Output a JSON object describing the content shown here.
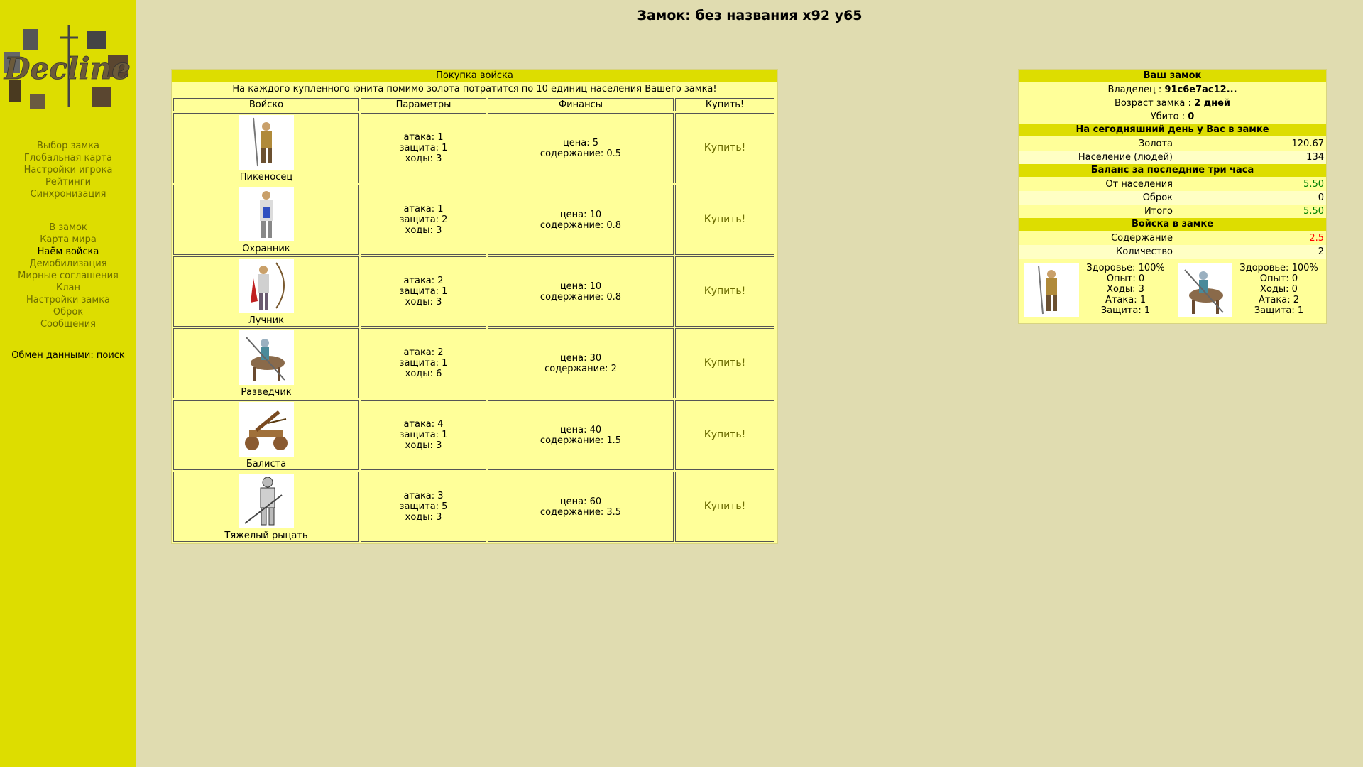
{
  "title": "Замок: без названия x92 y65",
  "sidebar": {
    "nav1": [
      "Выбор замка",
      "Глобальная карта",
      "Настройки игрока",
      "Рейтинги",
      "Синхронизация"
    ],
    "nav2": [
      "В замок",
      "Карта мира",
      "Наём войска",
      "Демобилизация",
      "Мирные соглашения",
      "Клан",
      "Настройки замка",
      "Оброк",
      "Сообщения"
    ],
    "active": "Наём войска",
    "exchange": "Обмен данными: поиск"
  },
  "buy": {
    "header": "Покупка войска",
    "note": "На каждого купленного юнита помимо золота потратится по 10 единиц населения Вашего замка!",
    "columns": [
      "Войско",
      "Параметры",
      "Финансы",
      "Купить!"
    ],
    "units": [
      {
        "name": "Пикеносец",
        "attack": "атака: 1",
        "defense": "защита: 1",
        "moves": "ходы: 3",
        "price": "цена: 5",
        "upkeep": "содержание: 0.5",
        "buy": "Купить!"
      },
      {
        "name": "Охранник",
        "attack": "атака: 1",
        "defense": "защита: 2",
        "moves": "ходы: 3",
        "price": "цена: 10",
        "upkeep": "содержание: 0.8",
        "buy": "Купить!"
      },
      {
        "name": "Лучник",
        "attack": "атака: 2",
        "defense": "защита: 1",
        "moves": "ходы: 3",
        "price": "цена: 10",
        "upkeep": "содержание: 0.8",
        "buy": "Купить!"
      },
      {
        "name": "Разведчик",
        "attack": "атака: 2",
        "defense": "защита: 1",
        "moves": "ходы: 6",
        "price": "цена: 30",
        "upkeep": "содержание: 2",
        "buy": "Купить!"
      },
      {
        "name": "Балиста",
        "attack": "атака: 4",
        "defense": "защита: 1",
        "moves": "ходы: 3",
        "price": "цена: 40",
        "upkeep": "содержание: 1.5",
        "buy": "Купить!"
      },
      {
        "name": "Тяжелый рыцать",
        "attack": "атака: 3",
        "defense": "защита: 5",
        "moves": "ходы: 3",
        "price": "цена: 60",
        "upkeep": "содержание: 3.5",
        "buy": "Купить!"
      }
    ]
  },
  "castle": {
    "header": "Ваш замок",
    "owner_label": "Владелец :",
    "owner": "91c6e7ac12...",
    "age_label": "Возраст замка :",
    "age": "2 дней",
    "killed_label": "Убито :",
    "killed": "0",
    "today_header": "На сегодняшний день у Вас в замке",
    "gold_label": "Золота",
    "gold": "120.67",
    "pop_label": "Население (людей)",
    "pop": "134",
    "balance_header": "Баланс за последние три часа",
    "from_pop_label": "От населения",
    "from_pop": "5.50",
    "obrok_label": "Оброк",
    "obrok": "0",
    "total_label": "Итого",
    "total": "5.50",
    "troops_header": "Войска в замке",
    "upkeep_label": "Содержание",
    "upkeep": "2.5",
    "count_label": "Количество",
    "count": "2",
    "army": [
      {
        "health": "Здоровье: 100%",
        "exp": "Опыт: 0",
        "moves": "Ходы: 3",
        "attack": "Атака: 1",
        "defense": "Защита: 1"
      },
      {
        "health": "Здоровье: 100%",
        "exp": "Опыт: 0",
        "moves": "Ходы: 0",
        "attack": "Атака: 2",
        "defense": "Защита: 1"
      }
    ]
  },
  "colors": {
    "sidebar": "#dddd00",
    "background": "#e0dcb0",
    "panel": "#ffff99",
    "positive": "#008000",
    "negative": "#ff0000"
  }
}
